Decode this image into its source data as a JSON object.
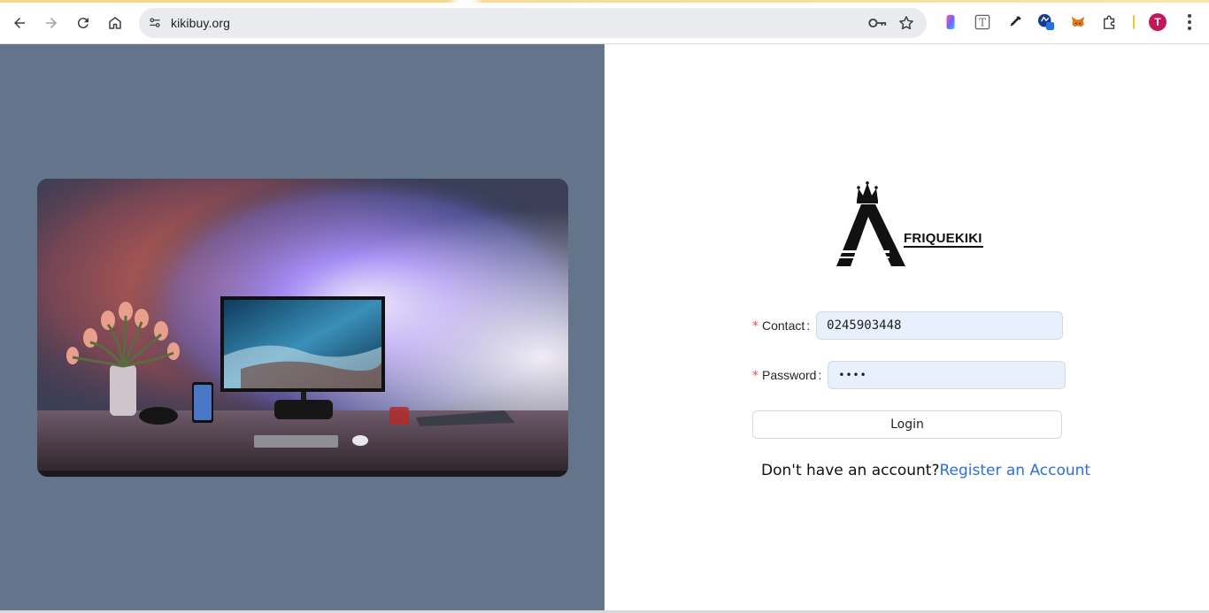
{
  "browser": {
    "url": "kikibuy.org",
    "back_icon": "arrow-left",
    "forward_icon": "arrow-right",
    "reload_icon": "reload",
    "home_icon": "home",
    "profile_initial": "T",
    "profile_color": "#c2185b"
  },
  "page": {
    "left_bg": "#64748b",
    "logo_text": "FRIQUEKIKI",
    "form": {
      "contact_label": "Contact",
      "contact_value": "0245903448",
      "password_label": "Password",
      "password_value": "••••",
      "required_mark": "*",
      "colon": ":",
      "login_label": "Login"
    },
    "register": {
      "prompt": "Don't have an account?",
      "link": "Register an Account",
      "link_color": "#2f6fd8"
    }
  }
}
